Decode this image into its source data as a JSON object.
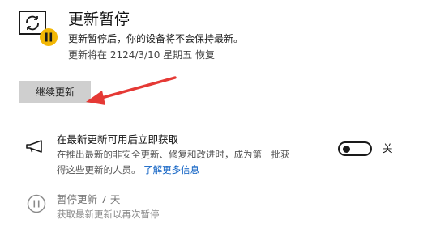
{
  "status": {
    "title": "更新暂停",
    "description": "更新暂停后，你的设备将不会保持最新。",
    "resume_info": "更新将在 2124/3/10 星期五 恢复",
    "resume_button_label": "继续更新",
    "icon": "update-paused-icon",
    "badge_color": "#f2b705"
  },
  "latest_updates": {
    "title": "在最新更新可用后立即获取",
    "description_line1": "在推出最新的非安全更新、修复和改进时，成为第一批获",
    "description_line2_prefix": "得这些更新的人员。",
    "learn_more_label": "了解更多信息",
    "toggle_state": "关",
    "toggle_on": false,
    "icon": "megaphone-icon"
  },
  "pause": {
    "title": "暂停更新 7 天",
    "description": "获取最新更新以再次暂停",
    "icon": "pause-circle-icon"
  },
  "colors": {
    "accent_link": "#0a5ec2",
    "annotation_arrow": "#e53935",
    "button_bg": "#cfcfcf"
  }
}
